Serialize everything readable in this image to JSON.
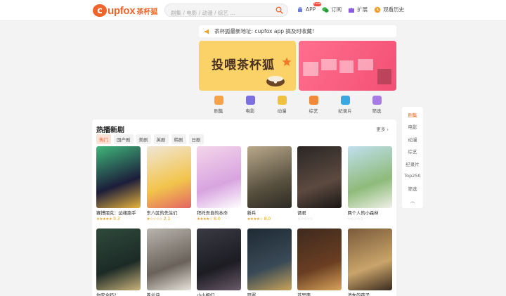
{
  "header": {
    "logo_mark": "c",
    "logo_text": "upfox",
    "logo_cn": "茶杯狐",
    "search_placeholder": "剧集 / 电影 / 动漫 / 综艺 ...",
    "nav": [
      {
        "label": "APP",
        "icon": "android-icon",
        "badge": "new"
      },
      {
        "label": "订阅",
        "icon": "wechat-icon"
      },
      {
        "label": "扩展",
        "icon": "puzzle-icon"
      },
      {
        "label": "观看历史",
        "icon": "clock-icon"
      }
    ]
  },
  "notice": {
    "text": "茶杯狐最新地址: cupfox app 搞及时收藏!"
  },
  "banners": [
    {
      "title": "投喂茶杯狐"
    }
  ],
  "categories": [
    {
      "label": "剧集",
      "color": "#f7a24a"
    },
    {
      "label": "电影",
      "color": "#7c6fe0"
    },
    {
      "label": "动漫",
      "color": "#f0c040"
    },
    {
      "label": "综艺",
      "color": "#f0893a"
    },
    {
      "label": "纪录片",
      "color": "#3aa8e0"
    },
    {
      "label": "筛选",
      "color": "#a77be6"
    }
  ],
  "section": {
    "title": "热播新剧",
    "more": "更多 ›",
    "tabs": [
      "热门",
      "国产剧",
      "美剧",
      "英剧",
      "韩剧",
      "日剧"
    ],
    "items": [
      {
        "title": "赛博朋克：边缘跑手",
        "stars": "★★★★★",
        "score": "9.3",
        "colors": [
          "#3fb67a",
          "#1c1d3a",
          "#e8b43a"
        ]
      },
      {
        "title": "东八区的先生们",
        "stars": "★☆☆☆☆",
        "score": "2.1",
        "colors": [
          "#f0e6d6",
          "#f2c44c",
          "#e46464"
        ]
      },
      {
        "title": "拜托吾自的本命",
        "stars": "★★★★☆",
        "score": "8.0",
        "colors": [
          "#f4d6ea",
          "#d8a4e0",
          "#ffffff"
        ]
      },
      {
        "title": "新兵",
        "stars": "★★★★☆",
        "score": "8.0",
        "colors": [
          "#b9a98c",
          "#5a5240",
          "#2c2a24"
        ]
      },
      {
        "title": "请君",
        "stars": "☆☆☆☆☆",
        "score": "",
        "colors": [
          "#2a2624",
          "#5c4a40",
          "#1a1614"
        ]
      },
      {
        "title": "两个人的小森林",
        "stars": "☆☆☆☆☆",
        "score": "",
        "colors": [
          "#bfe0ee",
          "#8ebb7a",
          "#f0f0e8"
        ]
      },
      {
        "title": "你安全吗?",
        "stars": "",
        "score": "",
        "colors": [
          "#2e4a3c",
          "#1c2a26",
          "#c9b37a"
        ]
      },
      {
        "title": "苍兰诀",
        "stars": "",
        "score": "",
        "colors": [
          "#b8b4ae",
          "#6a625a",
          "#e8e4dc"
        ]
      },
      {
        "title": "小小姐们",
        "stars": "",
        "score": "",
        "colors": [
          "#3a3a44",
          "#1c1c22",
          "#6a5a6a"
        ]
      },
      {
        "title": "罚罪",
        "stars": "",
        "score": "",
        "colors": [
          "#1e2a34",
          "#3a4a56",
          "#c9a45a"
        ]
      },
      {
        "title": "苏里南",
        "stars": "",
        "score": "",
        "colors": [
          "#3e2a1e",
          "#6a3e22",
          "#d8a45a"
        ]
      },
      {
        "title": "消失的孩子",
        "stars": "",
        "score": "",
        "colors": [
          "#7a5a3a",
          "#c9a46a",
          "#3a2a1e"
        ]
      }
    ]
  },
  "sidenav": [
    "剧集",
    "电影",
    "动漫",
    "综艺",
    "纪录片",
    "Top250",
    "筛选",
    "︿"
  ]
}
